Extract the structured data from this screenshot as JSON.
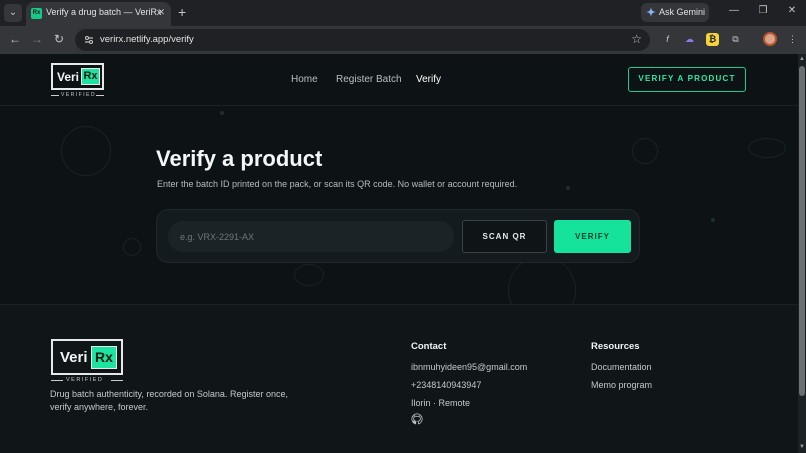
{
  "browser": {
    "tab_title": "Verify a drug batch — VeriRx",
    "tab_favicon": "Rx",
    "tab_close": "✕",
    "new_tab": "+",
    "ask_gemini": "Ask Gemini",
    "url": "verirx.netlify.app/verify",
    "window_controls": {
      "minimize": "—",
      "restore": "❐",
      "close": "✕"
    }
  },
  "brand": {
    "veri": "Veri",
    "rx": "Rx",
    "tagline": "VERIFIED",
    "accent_color": "#1ee3a0"
  },
  "nav": {
    "items": [
      "Home",
      "Register Batch",
      "Verify"
    ],
    "active": "Verify",
    "cta": "VERIFY A PRODUCT"
  },
  "hero": {
    "title": "Verify a product",
    "subtitle": "Enter the batch ID printed on the pack, or scan its QR code. No wallet or account required.",
    "input_placeholder": "e.g. VRX-2291-AX",
    "scan_label": "SCAN QR",
    "verify_label": "VERIFY"
  },
  "footer": {
    "description": "Drug batch authenticity, recorded on Solana. Register once, verify anywhere, forever.",
    "contact": {
      "title": "Contact",
      "email": "ibnmuhyideen95@gmail.com",
      "phone": "+2348140943947",
      "location": "Ilorin · Remote",
      "icon": "github-icon"
    },
    "resources": {
      "title": "Resources",
      "items": [
        "Documentation",
        "Memo program"
      ]
    }
  }
}
